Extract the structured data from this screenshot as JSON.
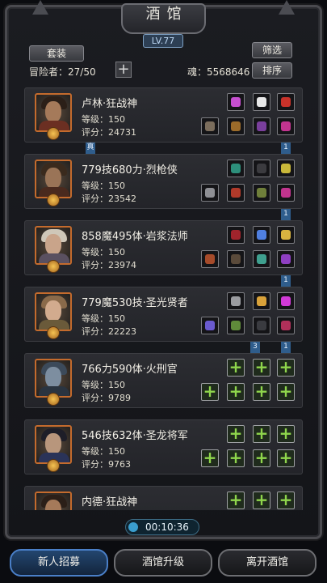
{
  "header": {
    "title": "酒馆",
    "level": "LV.77"
  },
  "toolbar": {
    "set_label": "套装",
    "filter_label": "筛选",
    "sort_label": "排序",
    "adventurer_label": "冒险者：27/50",
    "soul_label": "魂：5568646"
  },
  "heroes": [
    {
      "name": "卢林·狂战神",
      "level": "等级：150",
      "score": "评分：24731",
      "flag_left": "真",
      "flag_right": "1"
    },
    {
      "name": "779技680力·烈枪侠",
      "level": "等级：150",
      "score": "评分：23542",
      "flag_left": "",
      "flag_right": "1"
    },
    {
      "name": "858魔495体·岩浆法师",
      "level": "等级：150",
      "score": "评分：23974",
      "flag_left": "",
      "flag_right": "1"
    },
    {
      "name": "779魔530技·圣光贤者",
      "level": "等级：150",
      "score": "评分：22223",
      "flag_left": "3",
      "flag_right": "1"
    },
    {
      "name": "766力590体·火刑官",
      "level": "等级：150",
      "score": "评分：9789",
      "flag_left": "",
      "flag_right": ""
    },
    {
      "name": "546技632体·圣龙将军",
      "level": "等级：150",
      "score": "评分：9763",
      "flag_left": "",
      "flag_right": ""
    },
    {
      "name": "内德·狂战神",
      "level": "",
      "score": "",
      "flag_left": "",
      "flag_right": ""
    }
  ],
  "timer": "00:10:36",
  "bottom": {
    "recruit": "新人招募",
    "upgrade": "酒馆升级",
    "leave": "离开酒馆"
  },
  "colors": {
    "accent_blue": "#2f5d8c",
    "portrait_border": "#c46b2d",
    "plus_green": "#8fd64c"
  }
}
